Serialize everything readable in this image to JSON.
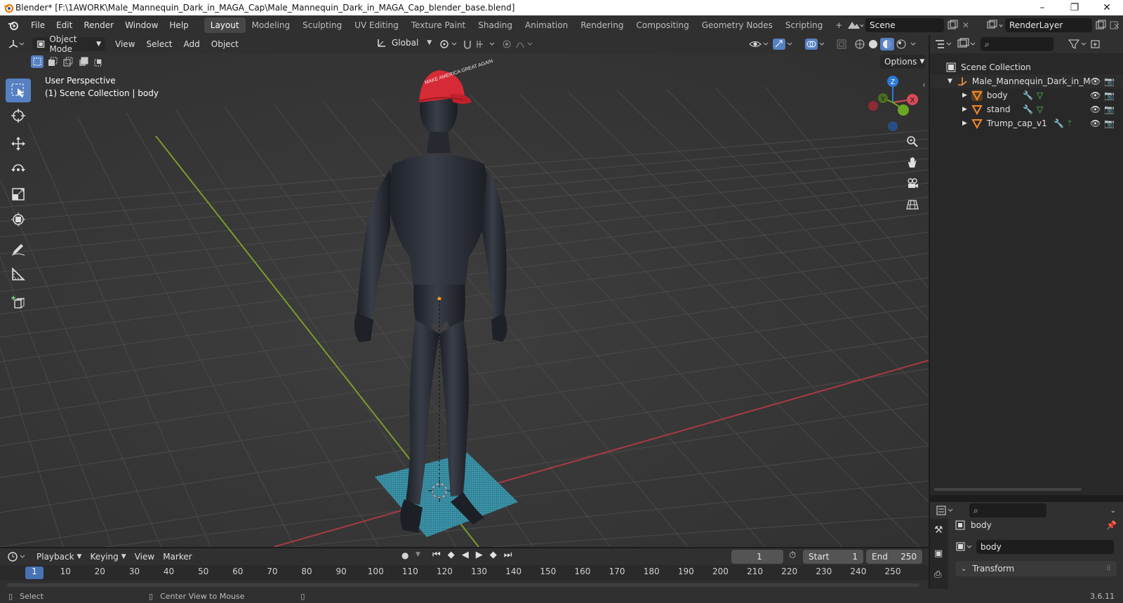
{
  "window": {
    "title": "Blender* [F:\\1AWORK\\Male_Mannequin_Dark_in_MAGA_Cap\\Male_Mannequin_Dark_in_MAGA_Cap_blender_base.blend]",
    "min": "–",
    "max": "❐",
    "close": "✕"
  },
  "menu": [
    "File",
    "Edit",
    "Render",
    "Window",
    "Help"
  ],
  "workspaces": {
    "active": "Layout",
    "items": [
      "Modeling",
      "Sculpting",
      "UV Editing",
      "Texture Paint",
      "Shading",
      "Animation",
      "Rendering",
      "Compositing",
      "Geometry Nodes",
      "Scripting"
    ],
    "add": "+"
  },
  "scene": {
    "name": "Scene",
    "renderlayer": "RenderLayer"
  },
  "viewport_header": {
    "mode": "Object Mode",
    "menus": [
      "View",
      "Select",
      "Add",
      "Object"
    ],
    "orientation": "Global",
    "options": "Options"
  },
  "viewport": {
    "perspective": "User Perspective",
    "collection_info": "(1) Scene Collection | body",
    "cap_text": "MAKE AMERICA GREAT AGAIN",
    "gizmo": {
      "x": "X",
      "y": "Y",
      "z": "Z"
    }
  },
  "outliner": {
    "root": "Scene Collection",
    "collection": "Male_Mannequin_Dark_in_M",
    "objects": [
      "body",
      "stand",
      "Trump_cap_v1"
    ]
  },
  "properties": {
    "object_name": "body",
    "mesh_name": "body",
    "panel": "Transform"
  },
  "timeline": {
    "menus": [
      "Playback",
      "Keying",
      "View",
      "Marker"
    ],
    "current_frame": "1",
    "start_label": "Start",
    "start": "1",
    "end_label": "End",
    "end": "250",
    "ticks": [
      "1",
      "10",
      "20",
      "30",
      "40",
      "50",
      "60",
      "70",
      "80",
      "90",
      "100",
      "110",
      "120",
      "130",
      "140",
      "150",
      "160",
      "170",
      "180",
      "190",
      "200",
      "210",
      "220",
      "230",
      "240",
      "250"
    ]
  },
  "status": {
    "select": "Select",
    "center": "Center View to Mouse",
    "version": "3.6.11"
  },
  "colors": {
    "accent": "#5680c2",
    "header": "#303030",
    "viewport": "#393939",
    "cap": "#d62b36"
  }
}
